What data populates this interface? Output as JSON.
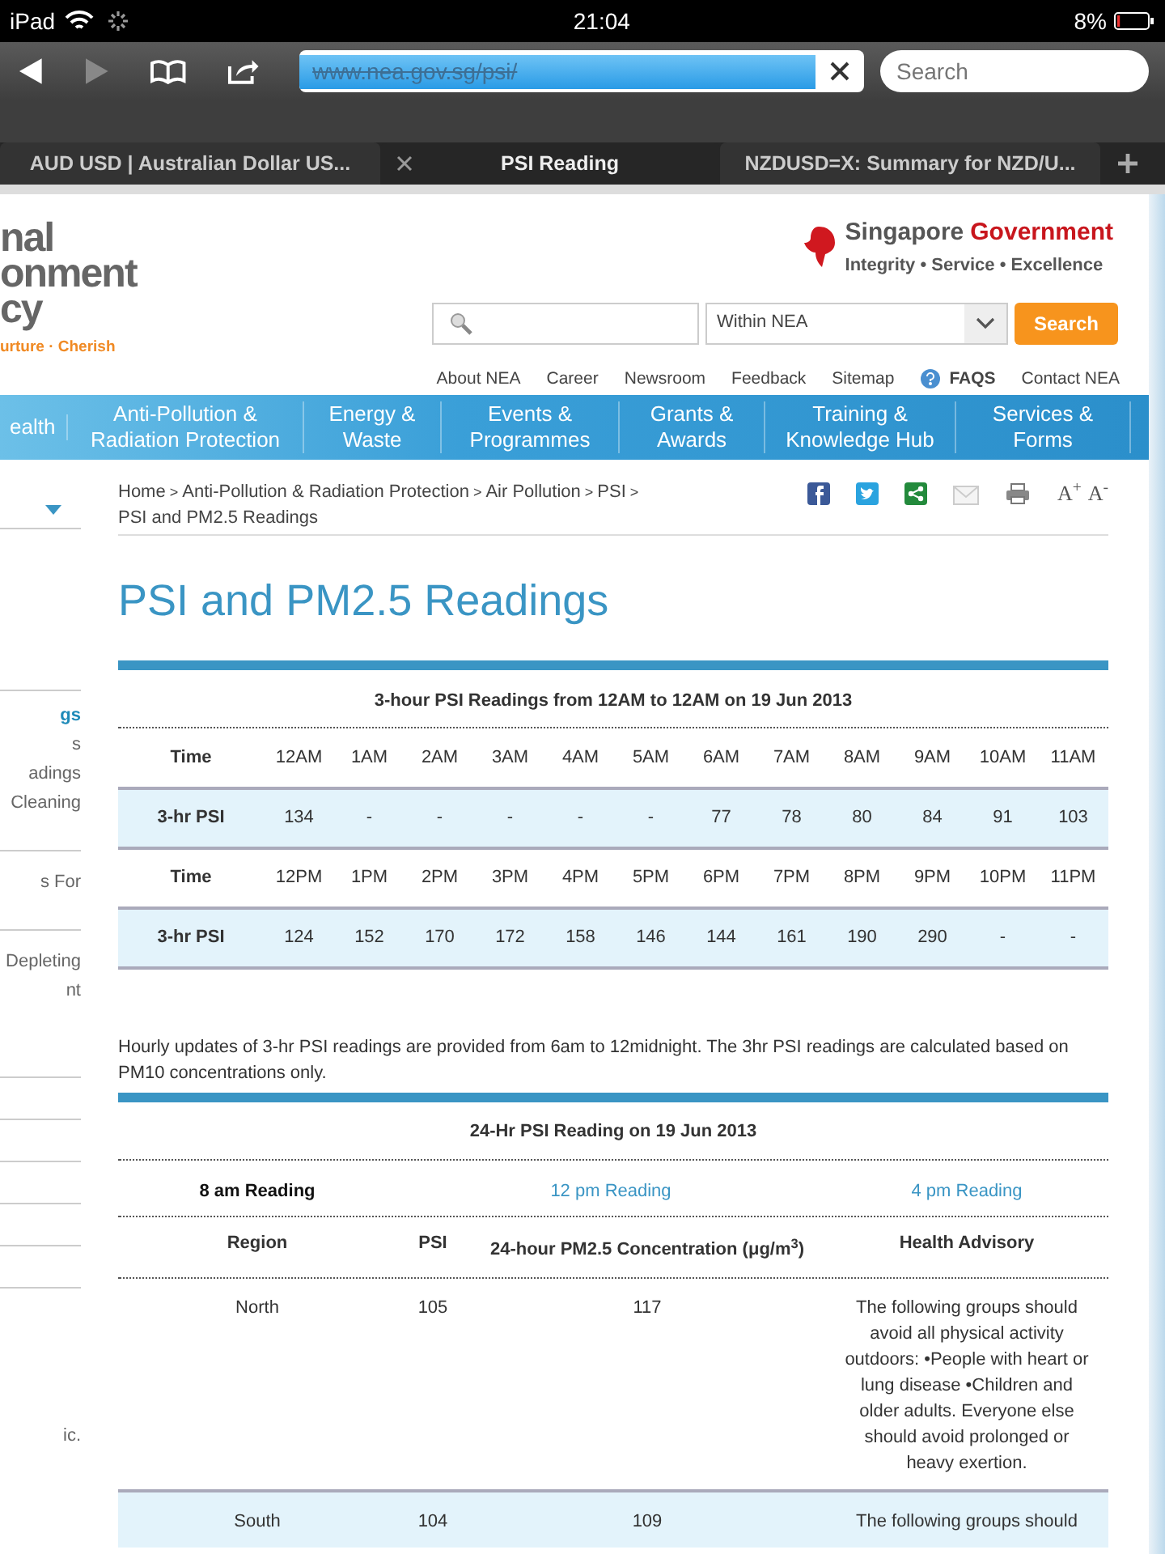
{
  "status_bar": {
    "device": "iPad",
    "time": "21:04",
    "battery": "8%"
  },
  "browser": {
    "url": "www.nea.gov.sg/psi/",
    "search_placeholder": "Search",
    "tabs": [
      {
        "label": "AUD USD | Australian Dollar US...",
        "selected": false
      },
      {
        "label": "PSI Reading",
        "selected": true
      },
      {
        "label": "NZDUSD=X: Summary for NZD/U...",
        "selected": false
      }
    ]
  },
  "header": {
    "logo_lines": [
      "nal",
      "onment",
      "cy"
    ],
    "logo_tagline": "urture · Cherish",
    "gov_logo": {
      "name_1": "Singapore",
      "name_2": "Government",
      "motto": "Integrity • Service • Excellence"
    },
    "search": {
      "scope": "Within NEA",
      "button": "Search"
    },
    "utility_links": [
      {
        "label": "About NEA",
        "kind": "plain"
      },
      {
        "label": "Career",
        "kind": "plain"
      },
      {
        "label": "Newsroom",
        "kind": "plain"
      },
      {
        "label": "Feedback",
        "kind": "plain"
      },
      {
        "label": "Sitemap",
        "kind": "plain"
      },
      {
        "label": "FAQS",
        "kind": "faq"
      },
      {
        "label": "Contact NEA",
        "kind": "plain"
      }
    ]
  },
  "nav": [
    "ealth",
    "Anti-Pollution & Radiation Protection",
    "Energy & Waste",
    "Events & Programmes",
    "Grants & Awards",
    "Training & Knowledge Hub",
    "Services & Forms"
  ],
  "sidebar": {
    "groups": [
      [
        {
          "text": "gs",
          "selected": true
        },
        {
          "text": "s",
          "selected": false
        },
        {
          "text": "adings",
          "selected": false
        },
        {
          "text": "Cleaning",
          "selected": false
        }
      ],
      [
        {
          "text": "s For",
          "selected": false
        }
      ],
      [
        {
          "text": "Depleting",
          "selected": false
        },
        {
          "text": "nt",
          "selected": false
        }
      ]
    ],
    "footer_text": "ic."
  },
  "breadcrumb": {
    "items": [
      "Home",
      "Anti-Pollution & Radiation Protection",
      "Air Pollution",
      "PSI",
      "PSI and PM2.5 Readings"
    ],
    "separator": ">"
  },
  "font_controls": [
    "A$^{+}$",
    "A$^{-}$"
  ],
  "title": "PSI and PM2.5 Readings",
  "three_hour_table": {
    "caption": "3-hour PSI Readings from 12AM to 12AM on 19 Jun 2013",
    "rows": [
      {
        "kind": "header",
        "cells": [
          "Time",
          "12AM",
          "1AM",
          "2AM",
          "3AM",
          "4AM",
          "5AM",
          "6AM",
          "7AM",
          "8AM",
          "9AM",
          "10AM",
          "11AM"
        ]
      },
      {
        "kind": "data",
        "cells": [
          "3-hr PSI",
          "134",
          "-",
          "-",
          "-",
          "-",
          "-",
          "77",
          "78",
          "80",
          "84",
          "91",
          "103"
        ]
      },
      {
        "kind": "header",
        "cells": [
          "Time",
          "12PM",
          "1PM",
          "2PM",
          "3PM",
          "4PM",
          "5PM",
          "6PM",
          "7PM",
          "8PM",
          "9PM",
          "10PM",
          "11PM"
        ]
      },
      {
        "kind": "data",
        "cells": [
          "3-hr PSI",
          "124",
          "152",
          "170",
          "172",
          "158",
          "146",
          "144",
          "161",
          "190",
          "290",
          "-",
          "-"
        ]
      }
    ]
  },
  "note": "Hourly updates of 3-hr PSI readings are provided from 6am to 12midnight. The 3hr PSI readings are calculated based on PM10 concentrations only.",
  "daily_table": {
    "caption": "24-Hr PSI Reading on 19 Jun 2013",
    "reading_tabs": [
      {
        "label": "8 am Reading",
        "selected": true
      },
      {
        "label": "12 pm Reading",
        "selected": false
      },
      {
        "label": "4 pm Reading",
        "selected": false
      }
    ],
    "columns": [
      "Region",
      "PSI",
      "24-hour PM2.5 Concentration (μg/m$^{3}$)",
      "Health Advisory"
    ],
    "rows": [
      {
        "cells": [
          "North",
          "105",
          "117",
          "The following groups should avoid all physical activity outdoors: •People with heart or lung disease •Children and older adults. Everyone else should avoid prolonged or heavy exertion."
        ]
      },
      {
        "cells": [
          "South",
          "104",
          "109",
          "The following groups should"
        ]
      }
    ]
  }
}
